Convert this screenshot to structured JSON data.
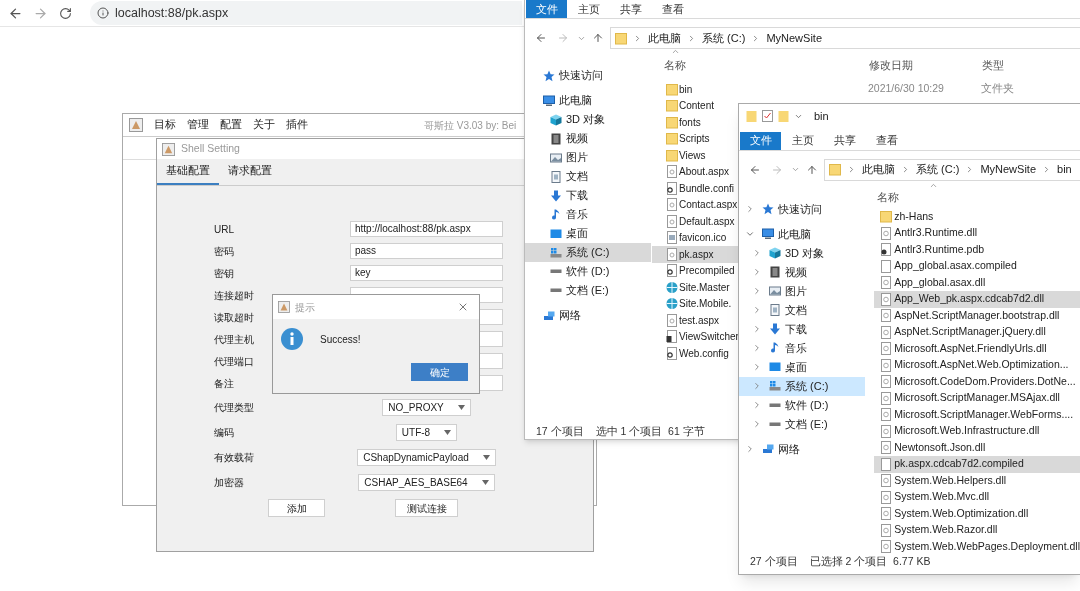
{
  "browser": {
    "url": "localhost:88/pk.aspx"
  },
  "main_window": {
    "menu": [
      "目标",
      "管理",
      "配置",
      "关于",
      "插件"
    ],
    "title": "哥斯拉 V3.03 by: Bei"
  },
  "shell_setting": {
    "title": "Shell Setting",
    "tabs": [
      {
        "label": "基础配置",
        "selected": true
      },
      {
        "label": "请求配置",
        "selected": false
      }
    ],
    "fields": [
      {
        "label": "URL",
        "value": "http://localhost:88/pk.aspx"
      },
      {
        "label": "密码",
        "value": "pass"
      },
      {
        "label": "密钥",
        "value": "key"
      },
      {
        "label": "连接超时"
      },
      {
        "label": "读取超时"
      },
      {
        "label": "代理主机"
      },
      {
        "label": "代理端口"
      },
      {
        "label": "备注"
      }
    ],
    "combos": [
      {
        "label": "代理类型",
        "value": "NO_PROXY"
      },
      {
        "label": "编码",
        "value": "UTF-8"
      },
      {
        "label": "有效载荷",
        "value": "CShapDynamicPayload"
      },
      {
        "label": "加密器",
        "value": "CSHAP_AES_BASE64"
      }
    ],
    "buttons": [
      "添加",
      "测试连接"
    ]
  },
  "message": {
    "title": "提示",
    "text": "Success!",
    "button": "确定"
  },
  "explorer_1": {
    "ribbon_tabs": [
      {
        "label": "文件",
        "kind": "file"
      },
      {
        "label": "主页",
        "kind": "tab"
      },
      {
        "label": "共享",
        "kind": "tab"
      },
      {
        "label": "查看",
        "kind": "tab"
      }
    ],
    "path": [
      "此电脑",
      "系统 (C:)",
      "MyNewSite"
    ],
    "columns": [
      "名称",
      "修改日期",
      "类型"
    ],
    "nav": [
      {
        "label": "快速访问",
        "kind": "star"
      },
      {
        "label": "此电脑",
        "kind": "pc",
        "children": [
          {
            "label": "3D 对象",
            "kind": "cube",
            "selected": false
          },
          {
            "label": "视频",
            "kind": "video",
            "selected": false
          },
          {
            "label": "图片",
            "kind": "picture",
            "selected": false
          },
          {
            "label": "文档",
            "kind": "doc",
            "selected": false
          },
          {
            "label": "下载",
            "kind": "download",
            "selected": false
          },
          {
            "label": "音乐",
            "kind": "music",
            "selected": false
          },
          {
            "label": "桌面",
            "kind": "desktop",
            "selected": false
          },
          {
            "label": "系统 (C:)",
            "kind": "sysdrive",
            "selected": true
          },
          {
            "label": "软件 (D:)",
            "kind": "drive",
            "selected": false
          },
          {
            "label": "文档 (E:)",
            "kind": "drive",
            "selected": false
          }
        ]
      },
      {
        "label": "网络",
        "kind": "network"
      }
    ],
    "files": [
      {
        "name": "bin",
        "kind": "folder",
        "selected": false,
        "date": "2021/6/30 10:29",
        "type": "文件夹"
      },
      {
        "name": "Content",
        "kind": "folder",
        "selected": false
      },
      {
        "name": "fonts",
        "kind": "folder",
        "selected": false
      },
      {
        "name": "Scripts",
        "kind": "folder",
        "selected": false
      },
      {
        "name": "Views",
        "kind": "folder",
        "selected": false
      },
      {
        "name": "About.aspx",
        "kind": "page",
        "selected": false
      },
      {
        "name": "Bundle.confi",
        "kind": "config",
        "selected": false
      },
      {
        "name": "Contact.aspx",
        "kind": "page",
        "selected": false
      },
      {
        "name": "Default.aspx",
        "kind": "page",
        "selected": false
      },
      {
        "name": "favicon.ico",
        "kind": "image",
        "selected": false
      },
      {
        "name": "pk.aspx",
        "kind": "page",
        "selected": true
      },
      {
        "name": "Precompiled",
        "kind": "config",
        "selected": false
      },
      {
        "name": "Site.Master",
        "kind": "globe",
        "selected": false
      },
      {
        "name": "Site.Mobile.",
        "kind": "globe",
        "selected": false
      },
      {
        "name": "test.aspx",
        "kind": "page",
        "selected": false
      },
      {
        "name": "ViewSwitcher",
        "kind": "control",
        "selected": false
      },
      {
        "name": "Web.config",
        "kind": "config",
        "selected": false
      }
    ],
    "status": [
      "17 个项目",
      "选中 1 个项目  61 字节"
    ]
  },
  "explorer_2": {
    "title": "bin",
    "ribbon_tabs": [
      {
        "label": "文件",
        "kind": "file"
      },
      {
        "label": "主页",
        "kind": "tab"
      },
      {
        "label": "共享",
        "kind": "tab"
      },
      {
        "label": "查看",
        "kind": "tab"
      }
    ],
    "path": [
      "此电脑",
      "系统 (C:)",
      "MyNewSite",
      "bin"
    ],
    "columns": [
      "名称"
    ],
    "nav": [
      {
        "label": "快速访问",
        "kind": "star",
        "expanded": false
      },
      {
        "label": "此电脑",
        "kind": "pc",
        "expanded": true,
        "children": [
          {
            "label": "3D 对象",
            "kind": "cube",
            "expanded": false,
            "selected": false
          },
          {
            "label": "视频",
            "kind": "video",
            "expanded": false,
            "selected": false
          },
          {
            "label": "图片",
            "kind": "picture",
            "expanded": false,
            "selected": false
          },
          {
            "label": "文档",
            "kind": "doc",
            "expanded": false,
            "selected": false
          },
          {
            "label": "下载",
            "kind": "download",
            "expanded": false,
            "selected": false
          },
          {
            "label": "音乐",
            "kind": "music",
            "expanded": false,
            "selected": false
          },
          {
            "label": "桌面",
            "kind": "desktop",
            "expanded": false,
            "selected": false
          },
          {
            "label": "系统 (C:)",
            "kind": "sysdrive",
            "expanded": false,
            "selected": true
          },
          {
            "label": "软件 (D:)",
            "kind": "drive",
            "expanded": false,
            "selected": false
          },
          {
            "label": "文档 (E:)",
            "kind": "drive",
            "expanded": false,
            "selected": false
          }
        ]
      },
      {
        "label": "网络",
        "kind": "network",
        "expanded": false
      }
    ],
    "files": [
      {
        "name": "zh-Hans",
        "kind": "folder",
        "selected": false
      },
      {
        "name": "Antlr3.Runtime.dll",
        "kind": "dll",
        "selected": false
      },
      {
        "name": "Antlr3.Runtime.pdb",
        "kind": "pdb",
        "selected": false
      },
      {
        "name": "App_global.asax.compiled",
        "kind": "blank",
        "selected": false
      },
      {
        "name": "App_global.asax.dll",
        "kind": "dll",
        "selected": false
      },
      {
        "name": "App_Web_pk.aspx.cdcab7d2.dll",
        "kind": "dll",
        "selected": true
      },
      {
        "name": "AspNet.ScriptManager.bootstrap.dll",
        "kind": "dll",
        "selected": false
      },
      {
        "name": "AspNet.ScriptManager.jQuery.dll",
        "kind": "dll",
        "selected": false
      },
      {
        "name": "Microsoft.AspNet.FriendlyUrls.dll",
        "kind": "dll",
        "selected": false
      },
      {
        "name": "Microsoft.AspNet.Web.Optimization...",
        "kind": "dll",
        "selected": false
      },
      {
        "name": "Microsoft.CodeDom.Providers.DotNe...",
        "kind": "dll",
        "selected": false
      },
      {
        "name": "Microsoft.ScriptManager.MSAjax.dll",
        "kind": "dll",
        "selected": false
      },
      {
        "name": "Microsoft.ScriptManager.WebForms....",
        "kind": "dll",
        "selected": false
      },
      {
        "name": "Microsoft.Web.Infrastructure.dll",
        "kind": "dll",
        "selected": false
      },
      {
        "name": "Newtonsoft.Json.dll",
        "kind": "dll",
        "selected": false
      },
      {
        "name": "pk.aspx.cdcab7d2.compiled",
        "kind": "blank",
        "selected": true
      },
      {
        "name": "System.Web.Helpers.dll",
        "kind": "dll",
        "selected": false
      },
      {
        "name": "System.Web.Mvc.dll",
        "kind": "dll",
        "selected": false
      },
      {
        "name": "System.Web.Optimization.dll",
        "kind": "dll",
        "selected": false
      },
      {
        "name": "System.Web.Razor.dll",
        "kind": "dll",
        "selected": false
      },
      {
        "name": "System.Web.WebPages.Deployment.dll",
        "kind": "dll",
        "selected": false
      }
    ],
    "status": [
      "27 个项目",
      "已选择 2 个项目  6.77 KB"
    ]
  }
}
